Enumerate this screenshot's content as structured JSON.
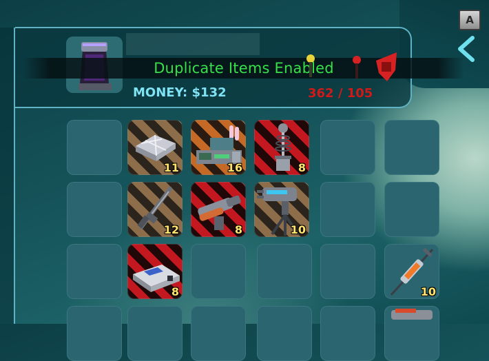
{
  "header": {
    "notification": "Duplicate Items Enabled",
    "money_label": "MONEY:",
    "money_value": "$132",
    "weight_current": "362",
    "weight_separator": "/",
    "weight_max": "105"
  },
  "controls": {
    "key_hint": "A",
    "back_icon": "chevron-left-icon"
  },
  "colors": {
    "notification": "#37e04a",
    "money": "#7fe3f4",
    "overweight": "#d01a1a",
    "quantity": "#ffe36a",
    "panel_border": "#5fb3c4"
  },
  "inventory": {
    "rows": [
      [
        {
          "item": null
        },
        {
          "item": "metal-plates-icon",
          "quantity": "11"
        },
        {
          "item": "tech-machinery-icon",
          "quantity": "16"
        },
        {
          "item": "tesla-coil-icon",
          "quantity": "8"
        },
        {
          "item": null
        },
        {
          "item": null
        }
      ],
      [
        {
          "item": null
        },
        {
          "item": "rifle-icon",
          "quantity": "12"
        },
        {
          "item": "heavy-blaster-icon",
          "quantity": "8"
        },
        {
          "item": "turret-icon",
          "quantity": "10"
        },
        {
          "item": null
        },
        {
          "item": null
        }
      ],
      [
        {
          "item": null
        },
        {
          "item": "keycard-device-icon",
          "quantity": "8"
        },
        {
          "item": null
        },
        {
          "item": null
        },
        {
          "item": null
        },
        {
          "item": "syringe-icon",
          "quantity": "10"
        }
      ]
    ]
  }
}
